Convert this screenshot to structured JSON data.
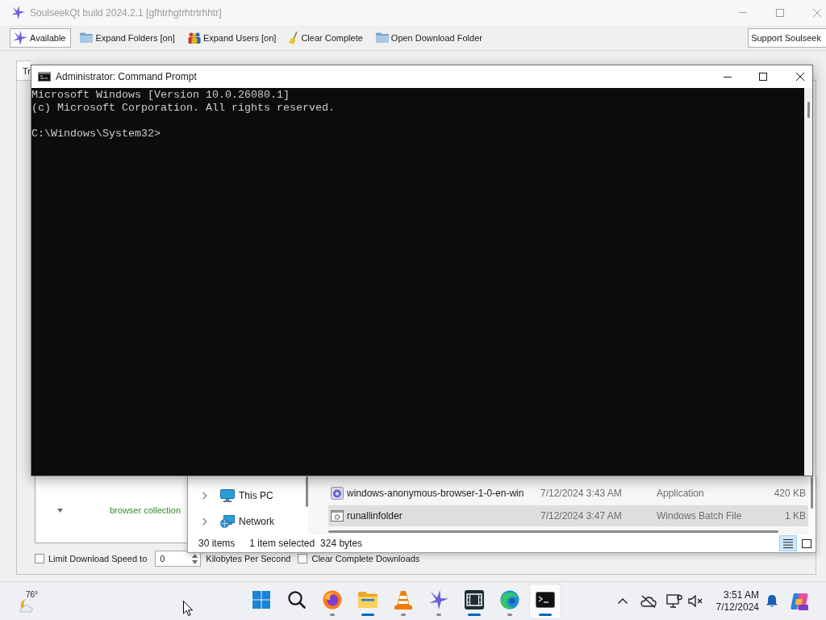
{
  "app_window": {
    "title": "SoulseekQt build 2024.2.1 [gfhtrhgtrhtrtrhhtr]",
    "focused": false,
    "toolbar": [
      {
        "kind": "status",
        "label": "Available"
      },
      {
        "kind": "folders",
        "label": "Expand Folders [on]"
      },
      {
        "kind": "users",
        "label": "Expand Users [on]"
      },
      {
        "kind": "clear",
        "label": "Clear Complete"
      },
      {
        "kind": "open",
        "label": "Open Download Folder"
      },
      {
        "kind": "support",
        "label": "Support Soulseek"
      }
    ],
    "tabs": [
      {
        "label": "Tr",
        "selected": true
      }
    ],
    "transfers": {
      "rows": [
        {
          "label": "browser collection",
          "expanded": true
        }
      ]
    },
    "download_options": {
      "limit_speed": {
        "label": "Limit Download Speed to",
        "checked": false
      },
      "speed": {
        "value": "0"
      },
      "unit": "Kilobytes Per Second",
      "clear_complete": {
        "label": "Clear Complete Downloads",
        "checked": false
      }
    }
  },
  "console_window": {
    "title": "Administrator: Command Prompt",
    "focused": true,
    "output": [
      "Microsoft Windows [Version 10.0.26080.1]",
      "(c) Microsoft Corporation. All rights reserved."
    ],
    "prompt": "C:\\Windows\\System32>"
  },
  "explorer_window": {
    "nav": [
      {
        "kind": "pc",
        "label": "This PC",
        "expanded": false
      },
      {
        "kind": "network",
        "label": "Network",
        "expanded": false
      }
    ],
    "files": [
      {
        "kind": "application",
        "name": "windows-anonymous-browser-1-0-en-win",
        "modified": "7/12/2024 3:43 AM",
        "type": "Application",
        "size": "420 KB",
        "selected": false
      },
      {
        "kind": "batch",
        "name": "runallinfolder",
        "modified": "7/12/2024 3:47 AM",
        "type": "Windows Batch File",
        "size": "1 KB",
        "selected": true
      }
    ],
    "status": {
      "count": "30 items",
      "selection": "1 item selected",
      "size": "324 bytes"
    },
    "views": [
      {
        "kind": "details",
        "selected": true
      },
      {
        "kind": "tiles",
        "selected": false
      }
    ]
  },
  "taskbar": {
    "weather": {
      "temperature": "76°"
    },
    "apps": [
      {
        "kind": "start",
        "selected": false
      },
      {
        "kind": "search",
        "selected": false
      },
      {
        "kind": "fox",
        "selected": false,
        "indicator": {
          "kind": "dash"
        }
      },
      {
        "kind": "folder",
        "selected": false,
        "indicator": {
          "kind": "bar"
        }
      },
      {
        "kind": "cone",
        "selected": false,
        "indicator": {
          "kind": "dash"
        }
      },
      {
        "kind": "bird",
        "selected": false,
        "indicator": {
          "kind": "dash"
        }
      },
      {
        "kind": "film",
        "selected": false,
        "indicator": {
          "kind": "bar"
        }
      },
      {
        "kind": "wave",
        "selected": false,
        "indicator": {
          "kind": "dash"
        }
      },
      {
        "kind": "terminal",
        "selected": true,
        "indicator": {
          "kind": "bar"
        }
      }
    ],
    "clock": {
      "time": "3:51 AM",
      "date": "7/12/2024"
    }
  }
}
